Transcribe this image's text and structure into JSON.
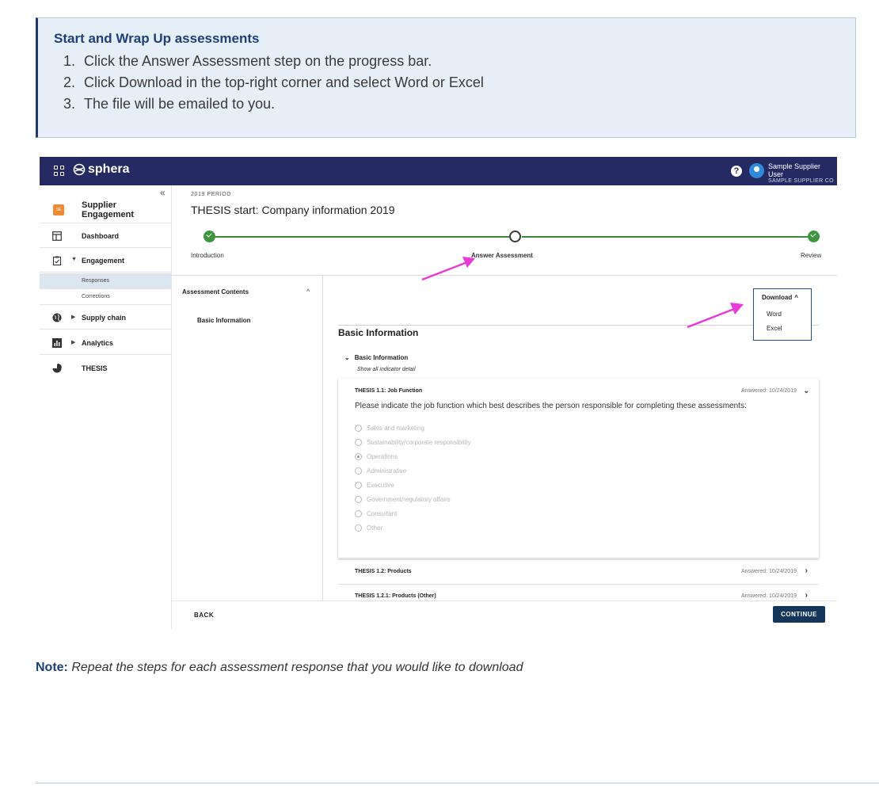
{
  "callout": {
    "title": "Start and Wrap Up assessments",
    "steps": [
      {
        "num": "1.",
        "text": "Click the Answer Assessment step on the progress bar."
      },
      {
        "num": "2.",
        "text": "Click Download in the top-right corner and select Word or Excel"
      },
      {
        "num": "3.",
        "text": "The file will be emailed to you."
      }
    ]
  },
  "app": {
    "logo_text": "sphera",
    "user_name": "Sample Supplier User",
    "user_company": "SAMPLE SUPPLIER CO",
    "help_glyph": "?",
    "collapse_glyph": "«"
  },
  "sidebar": {
    "brand": "Supplier Engagement",
    "items": [
      {
        "label": "Dashboard",
        "icon": "dashboard-icon"
      },
      {
        "label": "Engagement",
        "icon": "clipboard-icon"
      },
      {
        "label": "Supply chain",
        "icon": "globe-icon"
      },
      {
        "label": "Analytics",
        "icon": "bar-chart-icon"
      },
      {
        "label": "THESIS",
        "icon": "pie-chart-icon"
      }
    ],
    "subitems": [
      "Responses",
      "Corrections"
    ]
  },
  "main": {
    "period": "2019 PERIOD",
    "title": "THESIS start: Company information 2019",
    "steps": [
      "Introduction",
      "Answer Assessment",
      "Review"
    ],
    "contents_title": "Assessment Contents",
    "contents_item": "Basic Information",
    "section_title": "Basic Information",
    "sub_head": "Basic Information",
    "sub_link": "Show all indicator detail",
    "question": {
      "title": "THESIS 1.1: Job Function",
      "answered": "Answered: 10/24/2019",
      "text": "Please indicate the job function which best describes the person responsible for completing these assessments:",
      "options": [
        "Sales and marketing",
        "Sustainability/corporate responsibility",
        "Operations",
        "Administrative",
        "Executive",
        "Government/regulatory affairs",
        "Consultant",
        "Other"
      ],
      "selected_index": 2
    },
    "rows": [
      {
        "title": "THESIS 1.2: Products",
        "answered": "Answered: 10/24/2019"
      },
      {
        "title": "THESIS 1.2.1: Products (Other)",
        "answered": "Answered: 10/24/2019"
      }
    ],
    "back": "BACK",
    "continue": "CONTINUE",
    "download": {
      "label": "Download",
      "options": [
        "Word",
        "Excel"
      ]
    }
  },
  "note": {
    "label": "Note:",
    "text": "Repeat the steps for each assessment response that you would like to download"
  },
  "colors": {
    "topbar": "#262a63",
    "accent": "#14365b",
    "arrow": "#e83ad6",
    "progress": "#3f953f"
  }
}
